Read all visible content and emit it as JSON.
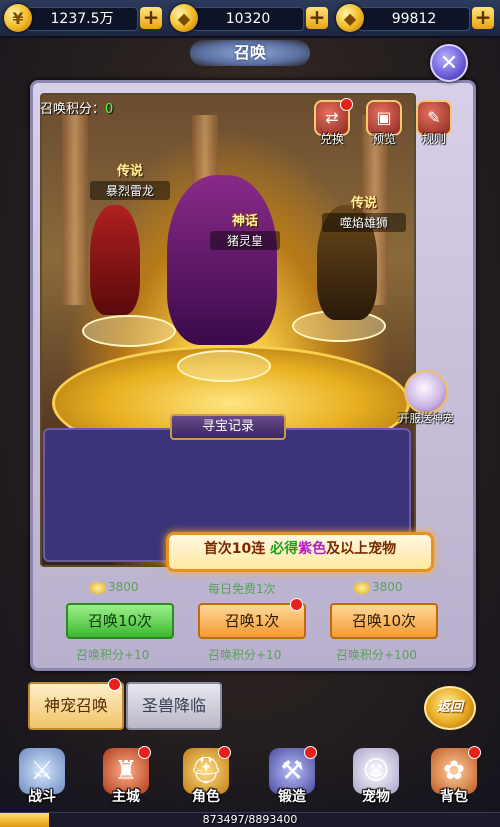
{
  "resources": [
    {
      "value": "1237.5万",
      "icon": "gold-coin-icon"
    },
    {
      "value": "10320",
      "icon": "gold-ingot-lock-icon"
    },
    {
      "value": "99812",
      "icon": "gold-ingot-icon"
    }
  ],
  "title": "召唤",
  "summon_points": {
    "label": "召唤积分：",
    "value": "0"
  },
  "tools": [
    {
      "label": "兑换",
      "icon": "exchange-icon",
      "badge": true
    },
    {
      "label": "预览",
      "icon": "chest-icon",
      "badge": false
    },
    {
      "label": "规则",
      "icon": "scroll-icon",
      "badge": false
    }
  ],
  "heroes": [
    {
      "tag": "传说",
      "name": "暴烈雷龙"
    },
    {
      "tag": "神话",
      "name": "猪灵皇"
    },
    {
      "tag": "传说",
      "name": "噬焰雄狮"
    }
  ],
  "log_title": "寻宝记录",
  "spirit_label": "开服送神宠",
  "promo": {
    "a": "首次10连 ",
    "b": "必得",
    "c": "紫色",
    "d": "及以上宠物"
  },
  "summon": [
    {
      "cost": "3800",
      "button": "召唤10次",
      "gain": "召唤积分+10",
      "style": "green",
      "badge": false
    },
    {
      "cost": "每日免费1次",
      "button": "召唤1次",
      "gain": "召唤积分+10",
      "style": "orange",
      "badge": true
    },
    {
      "cost": "3800",
      "button": "召唤10次",
      "gain": "召唤积分+100",
      "style": "orange",
      "badge": false
    }
  ],
  "tabs": {
    "active": "神宠召唤",
    "inactive": "圣兽降临"
  },
  "back_label": "返回",
  "nav": [
    {
      "label": "战斗",
      "icon": "crossed-swords-icon",
      "badge": false
    },
    {
      "label": "主城",
      "icon": "castle-icon",
      "badge": true
    },
    {
      "label": "角色",
      "icon": "helmet-icon",
      "badge": true
    },
    {
      "label": "锻造",
      "icon": "anvil-icon",
      "badge": true
    },
    {
      "label": "宠物",
      "icon": "pet-cat-icon",
      "badge": false
    },
    {
      "label": "背包",
      "icon": "bag-icon",
      "badge": true
    }
  ],
  "xp": {
    "text": "873497/8893400",
    "fraction": 0.098
  }
}
